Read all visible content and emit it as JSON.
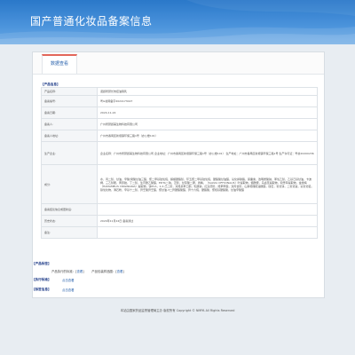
{
  "header": {
    "title": "国产普通化妆品备案信息"
  },
  "tabs": [
    {
      "label": "数据查看"
    }
  ],
  "section_title": "【产品信息】",
  "product_info_rows": [
    {
      "label": "产品名称:",
      "value": "诺颜所研长效控油隔乳"
    },
    {
      "label": "备案编号:",
      "value": "粤G妆网备字2024173027"
    },
    {
      "label": "备案日期:",
      "value": "2024-11-24"
    },
    {
      "label": "备案人:",
      "value": "广州所研颜美生物科技有限公司"
    },
    {
      "label": "备案人地址:",
      "value": "广州市番禺区新塘镇环保三路1号（办公楼101）"
    },
    {
      "label": "生产企业:",
      "value": "企业名称：广州市所研颜美生物科技有限公司 企业地址：广州市番禺区新塘镇环保三路1号（办公楼101） 生产地址：广州市番禺区新塘镇环保三路1号 生产许可证：粤妆20200236"
    },
    {
      "label": "成分:",
      "value": "水，丙二醇，甘油，辛酸/癸酸甘油三酯，聚二甲基硅氧烷，鲸蜡硬脂醇，环五聚二甲基硅氧烷，硬脂酸甘油酯，氢化卵磷脂，尿囊素，透明质酸钠，苯氧乙醇，乙基己基甘油，卡波姆，三乙醇胺，黄原胶，丁二醇，生育酚乙酸酯，EDTA二钠，泛醇，甘草酸二钾，香精，（SALVIA OFFICINALIS）叶提取物，烟酰胺，马齿苋提取物，积雪草提取物，金缕梅（HAMAMELIS VIRGINIANA）提取物，锌PCA，1,2-己二醇，对羟基苯乙酮，乳酸钠，红没药醇，羟苯甲酯，双丙甘醇，山梨坦橄榄油酸酯，硅石，氧化锌，二氧化钛，氢氧化铝，铁氧化物，滑石粉，辛基十二醇，异壬酸异壬酯，聚甘油-3二异硬脂酸酯，异十六烷，硬脂酸，聚羟基硬脂酸，甘油辛酸酯"
    },
    {
      "label": "备案结论信息或更新后:",
      "value": ""
    },
    {
      "label": "历史状态:",
      "value": "2024年11月24日 备案通过"
    },
    {
      "label": "备注:",
      "value": ""
    }
  ],
  "label_section": {
    "title": "【产品标签】",
    "standard_label": "产品执行的标准：",
    "standard_link": "查看",
    "label_file": "产品包装样品图：",
    "label_link": "查看"
  },
  "review_section": {
    "title": "【执行标准】",
    "link": "点击查看"
  },
  "label_info_section": {
    "title": "【标签信息】",
    "link": "点击查看"
  },
  "footer": {
    "text": "本站由国家药品监督管理局主办 版权所有 Copyright © NMPA All Rights Reserved"
  },
  "colors": {
    "banner": "#2a78c9",
    "accent_tab": "#e2665a",
    "link": "#2a63ad",
    "heading": "#1f3c88"
  }
}
